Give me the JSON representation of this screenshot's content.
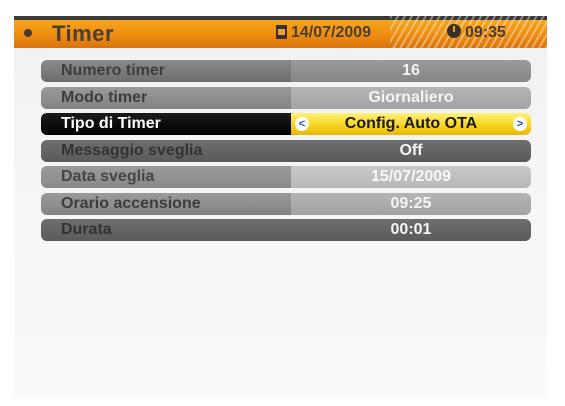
{
  "header": {
    "title": "Timer",
    "date": "14/07/2009",
    "time": "09:35",
    "accent_color": "#ee8c10"
  },
  "rows": [
    {
      "label": "Numero timer",
      "value": "16"
    },
    {
      "label": "Modo timer",
      "value": "Giornaliero"
    },
    {
      "label": "Tipo di Timer",
      "value": "Config. Auto OTA",
      "selected": true,
      "left_arrow": "<",
      "right_arrow": ">"
    },
    {
      "label": "Messaggio sveglia",
      "value": "Off"
    },
    {
      "label": "Data sveglia",
      "value": "15/07/2009"
    },
    {
      "label": "Orario accensione",
      "value": "09:25"
    },
    {
      "label": "Durata",
      "value": "00:01"
    }
  ],
  "colors": {
    "selected_value_bg": "#f6d21a",
    "selected_label_bg": "#000000",
    "arrow_color": "#2a4fb0"
  }
}
